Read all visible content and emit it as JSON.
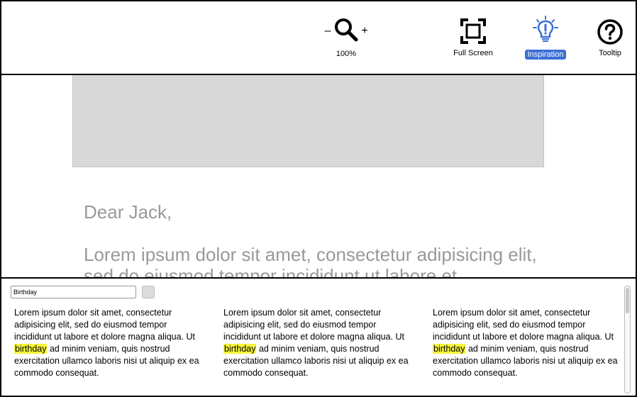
{
  "toolbar": {
    "zoom": {
      "minus": "–",
      "plus": "+",
      "level": "100%"
    },
    "fullscreen_label": "Full Screen",
    "inspiration_label": "Inspiration",
    "tooltip_label": "Tooltip",
    "accent_color": "#3b6fd6"
  },
  "document": {
    "greeting": "Dear Jack,",
    "body": "Lorem ipsum dolor sit amet, consectetur adipisicing elit, sed do eiusmod tempor incididunt ut labore et"
  },
  "panel": {
    "search_value": "Birthday",
    "results": [
      {
        "before": "Lorem ipsum dolor sit amet, consectetur adipisicing elit, sed do eiusmod tempor incididunt ut labore et dolore magna aliqua. Ut ",
        "match": "birthday",
        "after": " ad minim veniam, quis nostrud exercitation ullamco laboris nisi ut aliquip ex ea commodo consequat."
      },
      {
        "before": "Lorem ipsum dolor sit amet, consectetur adipisicing elit, sed do eiusmod tempor incididunt ut labore et dolore magna aliqua. Ut ",
        "match": "birthday",
        "after": " ad minim veniam, quis nostrud exercitation ullamco laboris nisi ut aliquip ex ea commodo consequat."
      },
      {
        "before": "Lorem ipsum dolor sit amet, consectetur adipisicing elit, sed do eiusmod tempor incididunt ut labore et dolore magna aliqua. Ut ",
        "match": "birthday",
        "after": " ad minim veniam, quis nostrud exercitation ullamco laboris nisi ut aliquip ex ea commodo consequat."
      }
    ],
    "highlight_color": "#f5f53a"
  },
  "icons": [
    "zoom-icon",
    "fullscreen-icon",
    "lightbulb-icon",
    "help-icon"
  ]
}
